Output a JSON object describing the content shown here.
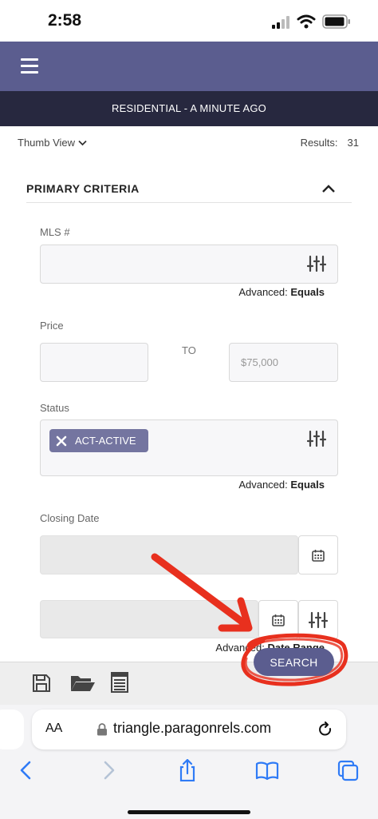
{
  "status_bar": {
    "time": "2:58"
  },
  "header": {
    "subtitle": "RESIDENTIAL - A MINUTE AGO"
  },
  "view_bar": {
    "view_label": "Thumb View",
    "results_label": "Results:",
    "results_count": "31"
  },
  "section": {
    "title": "PRIMARY CRITERIA",
    "fields": {
      "mls": {
        "label": "MLS #",
        "value": "",
        "advanced_prefix": "Advanced:",
        "advanced_value": "Equals"
      },
      "price": {
        "label": "Price",
        "min_value": "",
        "to_label": "TO",
        "max_placeholder": "$75,000"
      },
      "status": {
        "label": "Status",
        "chip": "ACT-ACTIVE",
        "advanced_prefix": "Advanced:",
        "advanced_value": "Equals"
      },
      "closing_date": {
        "label": "Closing Date",
        "advanced_prefix": "Advanced:",
        "advanced_value": "Date Range"
      }
    }
  },
  "actions": {
    "search_label": "SEARCH"
  },
  "browser": {
    "text_size": "AA",
    "url": "triangle.paragonrels.com"
  },
  "colors": {
    "brand": "#5b5d8f",
    "header_dark": "#27283f",
    "chip": "#7475a0",
    "annotation": "#e8301e",
    "ios_blue": "#2f7bf6"
  }
}
